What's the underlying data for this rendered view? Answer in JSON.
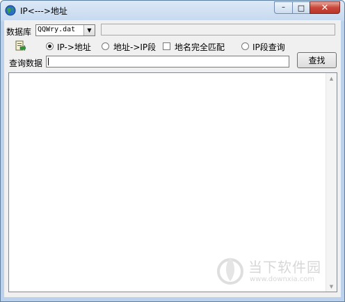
{
  "window": {
    "title": "IP<--->地址"
  },
  "caption": {
    "minimize": "–",
    "maximize": "□",
    "close": "✕"
  },
  "database": {
    "label": "数据库",
    "selected": "QQWry.dat"
  },
  "modes": {
    "ip_to_addr": "IP->地址",
    "addr_to_ip": "地址->IP段",
    "exact_match": "地名完全匹配",
    "ip_range_query": "IP段查询",
    "selected": "ip_to_addr"
  },
  "query": {
    "label": "查询数据",
    "value": ""
  },
  "search_button": {
    "label": "查找"
  },
  "icons": {
    "app": "globe-icon",
    "export": "export-icon"
  },
  "watermark": {
    "text": "当下软件园",
    "url": "www.downxia.com"
  }
}
